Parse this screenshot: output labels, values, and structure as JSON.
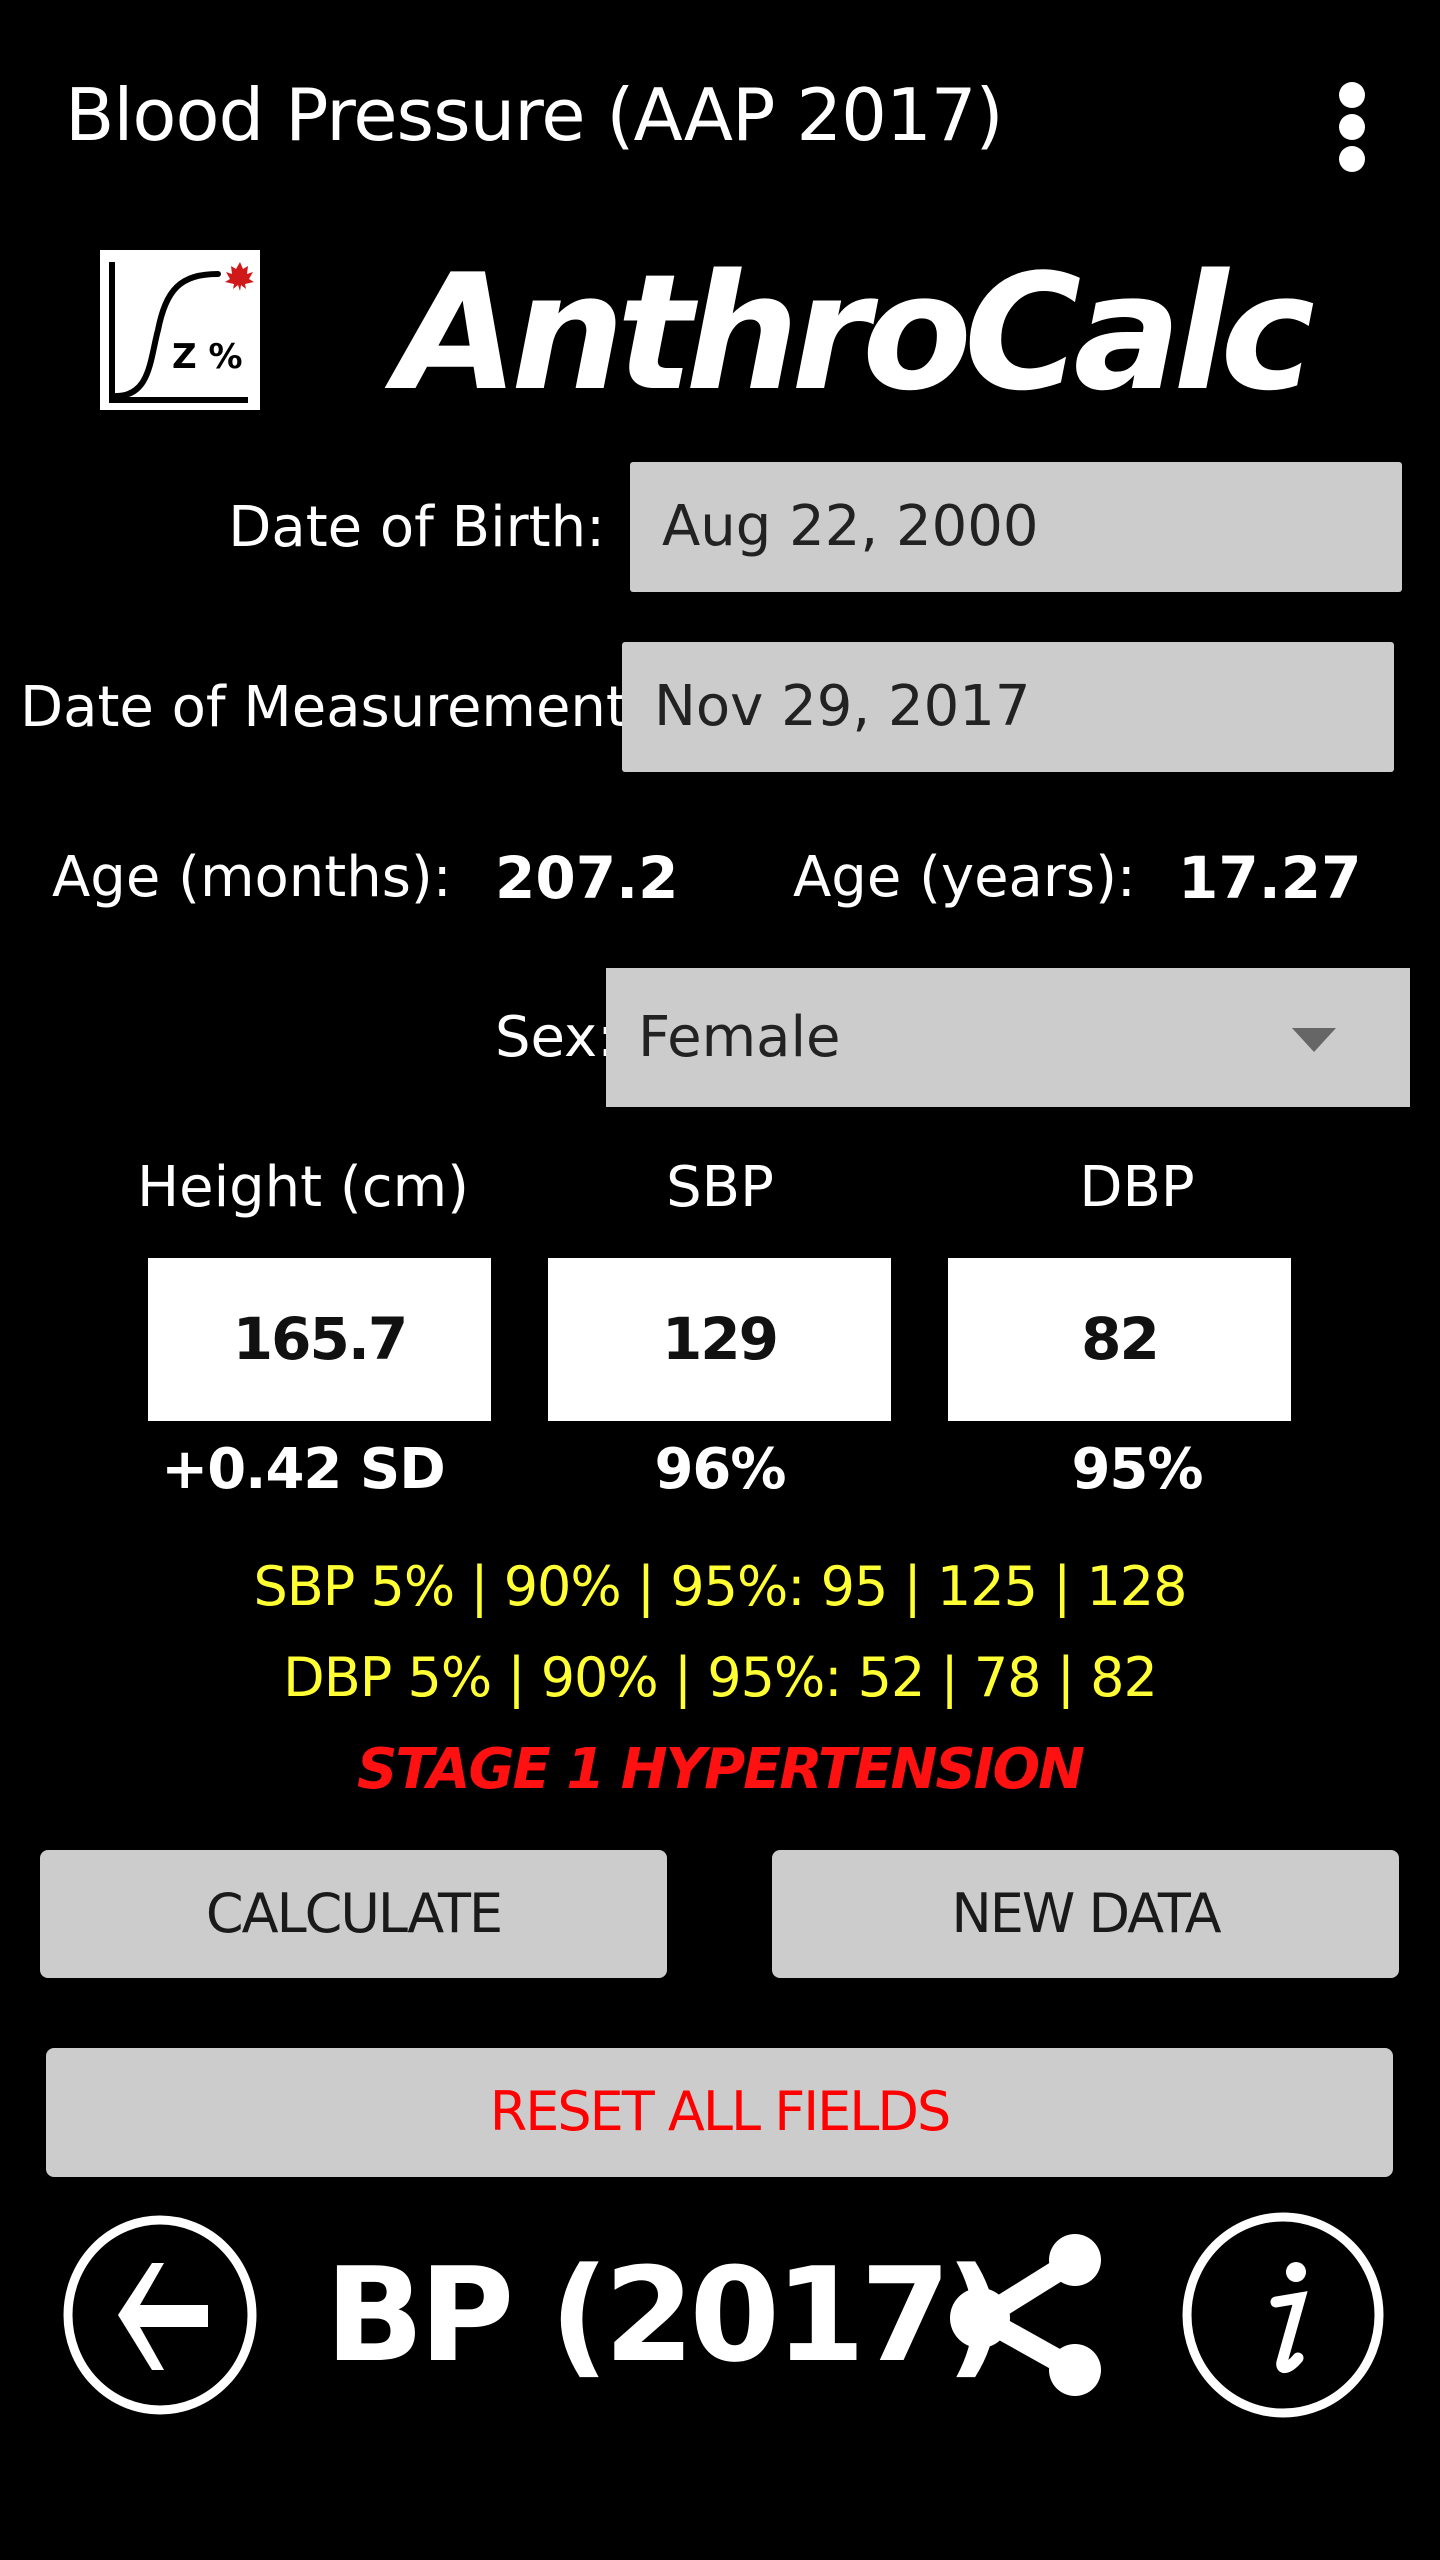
{
  "header": {
    "title": "Blood Pressure (AAP 2017)",
    "menu_icon": "overflow-menu-icon"
  },
  "brand": {
    "logo_icon": "z-percent-growth-curve-logo",
    "logo_text": "Z %",
    "name": "AnthroCalc"
  },
  "form": {
    "dob_label": "Date of Birth:",
    "dob_value": "Aug 22, 2000",
    "dom_label": "Date of Measurement:",
    "dom_value": "Nov 29, 2017",
    "age_months_label": "Age (months):",
    "age_months_value": "207.2",
    "age_years_label": "Age (years):",
    "age_years_value": "17.27",
    "sex_label": "Sex:",
    "sex_value": "Female"
  },
  "measurements": {
    "columns": [
      {
        "label": "Height (cm)",
        "value": "165.7",
        "result": "+0.42 SD"
      },
      {
        "label": "SBP",
        "value": "129",
        "result": "96%"
      },
      {
        "label": "DBP",
        "value": "82",
        "result": "95%"
      }
    ]
  },
  "results": {
    "sbp_line": "SBP 5% | 90% | 95%: 95 | 125 | 128",
    "dbp_line": "DBP 5% | 90% | 95%: 52 | 78 | 82",
    "status": "STAGE 1 HYPERTENSION"
  },
  "buttons": {
    "calculate": "CALCULATE",
    "new_data": "NEW DATA",
    "reset": "RESET ALL FIELDS"
  },
  "footer": {
    "title": "BP (2017)",
    "back_icon": "back-arrow-icon",
    "share_icon": "share-icon",
    "info_icon": "info-icon"
  },
  "colors": {
    "background": "#000000",
    "field_bg": "#cccccc",
    "percentile_text": "#ffff33",
    "status_text": "#ff1111",
    "reset_text": "#ff0000"
  }
}
